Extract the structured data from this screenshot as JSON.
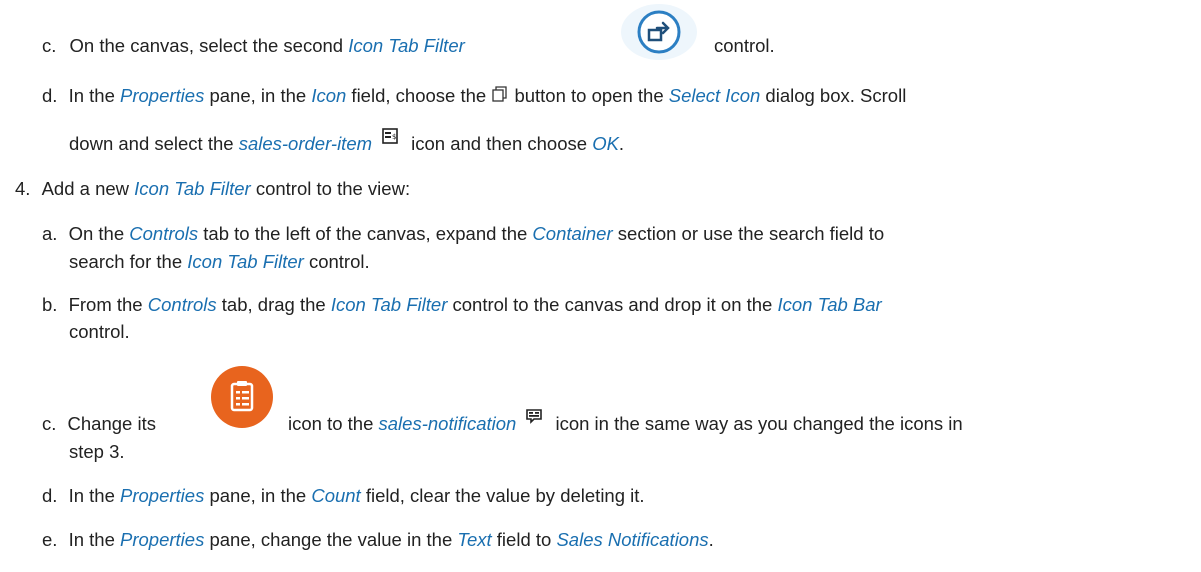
{
  "doc": {
    "c1": {
      "marker": "c.",
      "t1": "On the canvas, select the second ",
      "e1": "Icon Tab Filter",
      "t2": "control.",
      "icon": "export-arrow-icon"
    },
    "d1": {
      "marker": "d.",
      "t1": "In the ",
      "e1": "Properties",
      "t2": " pane, in the ",
      "e2": "Icon",
      "t3": " field, choose the ",
      "t4": " button to open the ",
      "e3": "Select Icon",
      "t5": " dialog box. Scroll",
      "icon": "value-help-icon"
    },
    "d1b": {
      "t1": "down and select the ",
      "e1": "sales-order-item",
      "t2": "icon and then choose ",
      "e2": "OK",
      "t3": ".",
      "icon": "sales-order-item-icon"
    },
    "s4": {
      "marker": "4.",
      "t1": "Add a new ",
      "e1": "Icon Tab Filter",
      "t2": " control to the view:"
    },
    "a": {
      "marker": "a.",
      "t1": "On the ",
      "e1": "Controls",
      "t2": " tab to the left of the canvas, expand the ",
      "e2": "Container",
      "t3": " section or use the search field to",
      "l2a": "search for the ",
      "e3": "Icon Tab Filter",
      "l2b": " control."
    },
    "b": {
      "marker": "b.",
      "t1": "From the ",
      "e1": "Controls",
      "t2": " tab, drag the ",
      "e2": "Icon Tab Filter",
      "t3": " control to the canvas and drop it on the ",
      "e3": "Icon Tab Bar",
      "l2": "control."
    },
    "c2": {
      "marker": "c.",
      "t1": "Change its",
      "t2": "icon to the ",
      "e1": "sales-notification",
      "t3": "icon in the same way as you changed the icons in",
      "l2": "step 3.",
      "icon1": "clipboard-task-icon",
      "icon2": "sales-notification-icon"
    },
    "d2": {
      "marker": "d.",
      "t1": "In the ",
      "e1": "Properties",
      "t2": " pane, in the ",
      "e2": "Count",
      "t3": " field, clear the value by deleting it."
    },
    "e": {
      "marker": "e.",
      "t1": "In the ",
      "e1": "Properties",
      "t2": " pane, change the value in the ",
      "e2": "Text",
      "t3": " field to ",
      "e3": "Sales Notifications",
      "t4": "."
    }
  }
}
